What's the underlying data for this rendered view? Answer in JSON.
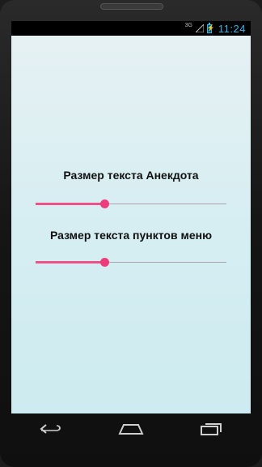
{
  "status_bar": {
    "network": "3G",
    "time": "11:24"
  },
  "settings": [
    {
      "label": "Размер текста Анекдота",
      "value_fraction": 0.36
    },
    {
      "label": "Размер текста пунктов меню",
      "value_fraction": 0.36
    }
  ],
  "colors": {
    "accent": "#ee3b7c",
    "clock": "#33b5e5",
    "screen_bg": "#d9eff2"
  },
  "nav": {
    "back": "back-icon",
    "home": "home-icon",
    "recents": "recents-icon"
  }
}
